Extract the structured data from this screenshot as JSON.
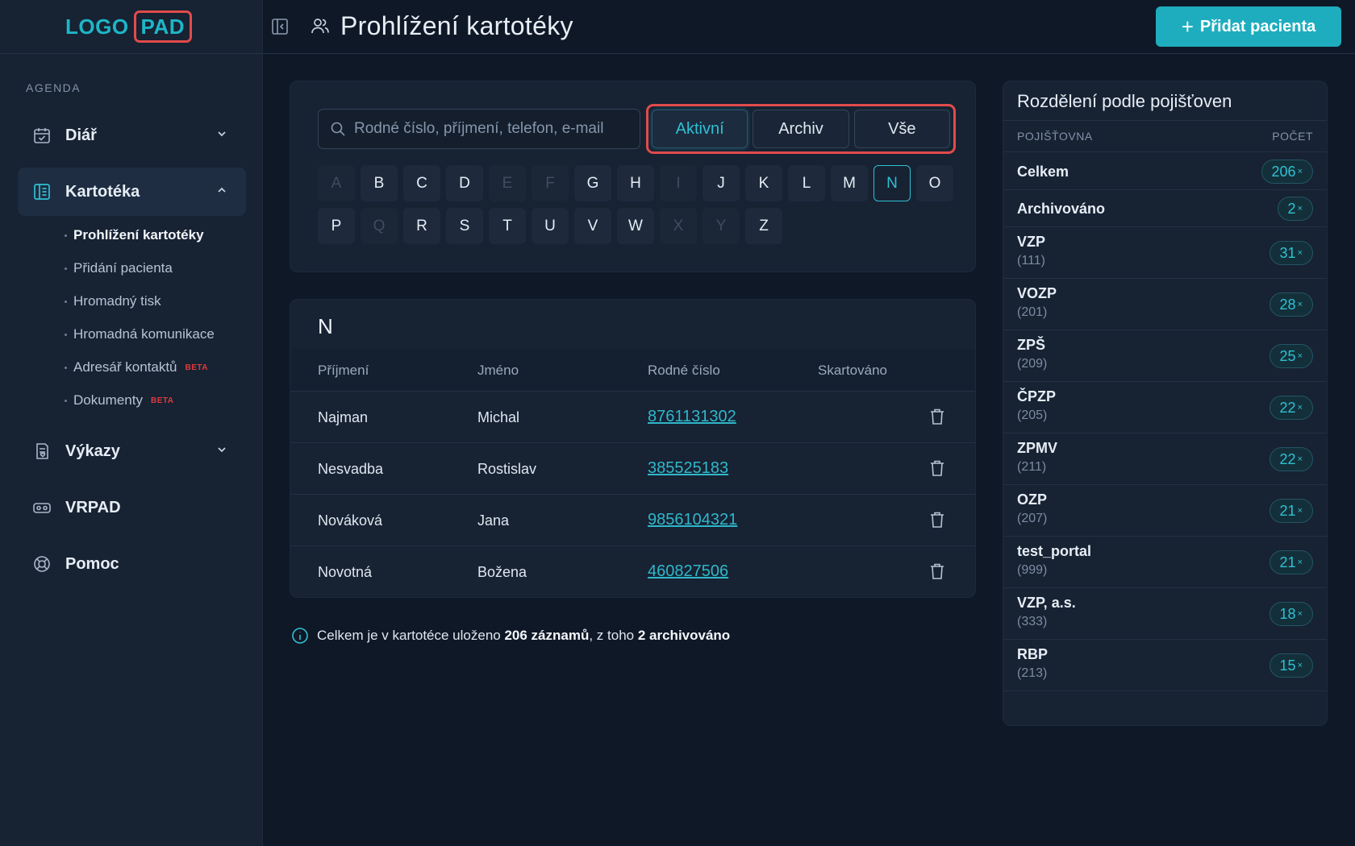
{
  "logo": {
    "part1": "LOGO",
    "part2": "PAD"
  },
  "sidebar": {
    "section_label": "AGENDA",
    "items": [
      {
        "label": "Diář"
      },
      {
        "label": "Kartotéka"
      },
      {
        "label": "Výkazy"
      },
      {
        "label": "VRPAD"
      },
      {
        "label": "Pomoc"
      }
    ],
    "sub_items": [
      {
        "label": "Prohlížení kartotéky"
      },
      {
        "label": "Přidání pacienta"
      },
      {
        "label": "Hromadný tisk"
      },
      {
        "label": "Hromadná komunikace"
      },
      {
        "label": "Adresář kontaktů",
        "badge": "BETA"
      },
      {
        "label": "Dokumenty",
        "badge": "BETA"
      }
    ]
  },
  "header": {
    "title": "Prohlížení kartotéky",
    "add_button": "Přidat pacienta"
  },
  "filter": {
    "search_placeholder": "Rodné číslo, příjmení, telefon, e-mail",
    "segments": [
      "Aktivní",
      "Archiv",
      "Vše"
    ],
    "active_segment": "Aktivní",
    "letters_row1": [
      "A",
      "B",
      "C",
      "D",
      "E",
      "F",
      "G",
      "H",
      "I",
      "J",
      "K",
      "L",
      "M",
      "N",
      "O"
    ],
    "letters_row2": [
      "P",
      "Q",
      "R",
      "S",
      "T",
      "U",
      "V",
      "W",
      "X",
      "Y",
      "Z"
    ],
    "disabled_letters": [
      "A",
      "E",
      "F",
      "I",
      "Q",
      "X",
      "Y"
    ],
    "active_letter": "N"
  },
  "table": {
    "group_letter": "N",
    "columns": [
      "Příjmení",
      "Jméno",
      "Rodné číslo",
      "Skartováno"
    ],
    "rows": [
      {
        "surname": "Najman",
        "name": "Michal",
        "birth_number": "8761131302",
        "shredded": ""
      },
      {
        "surname": "Nesvadba",
        "name": "Rostislav",
        "birth_number": "385525183",
        "shredded": ""
      },
      {
        "surname": "Nováková",
        "name": "Jana",
        "birth_number": "9856104321",
        "shredded": ""
      },
      {
        "surname": "Novotná",
        "name": "Božena",
        "birth_number": "460827506",
        "shredded": ""
      }
    ]
  },
  "info": {
    "prefix": "Celkem je v kartotéce uloženo",
    "total": "206 záznamů",
    "middle": ", z toho",
    "archived": "2 archivováno"
  },
  "insurance": {
    "title": "Rozdělení podle pojišťoven",
    "col_name": "POJIŠŤOVNA",
    "col_count": "POČET",
    "rows": [
      {
        "name": "Celkem",
        "code": "",
        "count": "206"
      },
      {
        "name": "Archivováno",
        "code": "",
        "count": "2"
      },
      {
        "name": "VZP",
        "code": "(111)",
        "count": "31"
      },
      {
        "name": "VOZP",
        "code": "(201)",
        "count": "28"
      },
      {
        "name": "ZPŠ",
        "code": "(209)",
        "count": "25"
      },
      {
        "name": "ČPZP",
        "code": "(205)",
        "count": "22"
      },
      {
        "name": "ZPMV",
        "code": "(211)",
        "count": "22"
      },
      {
        "name": "OZP",
        "code": "(207)",
        "count": "21"
      },
      {
        "name": "test_portal",
        "code": "(999)",
        "count": "21"
      },
      {
        "name": "VZP, a.s.",
        "code": "(333)",
        "count": "18"
      },
      {
        "name": "RBP",
        "code": "(213)",
        "count": "15"
      }
    ],
    "count_suffix": "×"
  },
  "colors": {
    "accent": "#1eadbf",
    "highlight_border": "#e24b4b",
    "background": "#0f1826",
    "panel": "#172233"
  }
}
